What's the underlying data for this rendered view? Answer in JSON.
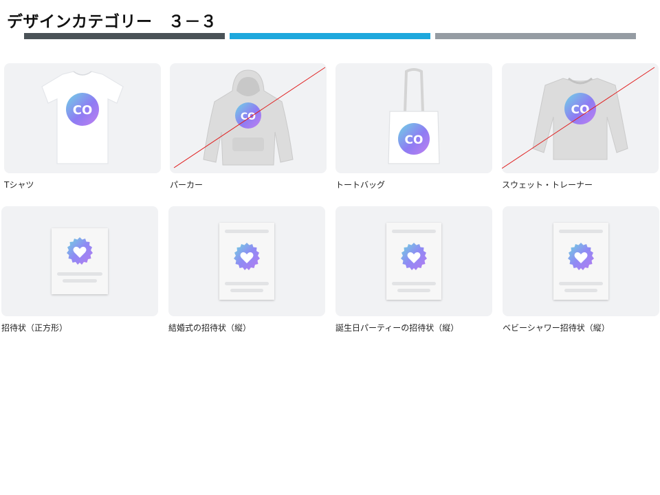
{
  "header": {
    "title": "デザインカテゴリー　３－３"
  },
  "progress": {
    "segments": [
      {
        "color": "#4a5257",
        "state": "done"
      },
      {
        "color": "#1ea8dd",
        "state": "current"
      },
      {
        "color": "#959ca3",
        "state": "upcoming"
      }
    ]
  },
  "colors": {
    "thumb_bg": "#f1f2f4",
    "strike": "#e02020",
    "logo_gradient": [
      "#7fd0e6",
      "#8b78f0",
      "#b77cf2"
    ]
  },
  "rows": [
    {
      "cards": [
        {
          "label": "Tシャツ",
          "image": "tshirt-mockup",
          "logo_text": "CO",
          "crossed_out": false
        },
        {
          "label": "パーカー",
          "image": "hoodie-mockup",
          "logo_text": "CO",
          "crossed_out": true
        },
        {
          "label": "トートバッグ",
          "image": "tote-bag-mockup",
          "logo_text": "CO",
          "crossed_out": false
        },
        {
          "label": "スウェット・トレーナー",
          "image": "sweatshirt-mockup",
          "logo_text": "CO",
          "crossed_out": true
        }
      ]
    },
    {
      "cards": [
        {
          "label": "招待状（正方形）",
          "image": "invitation-square",
          "crossed_out": false
        },
        {
          "label": "結婚式の招待状（縦）",
          "image": "wedding-invitation-portrait",
          "crossed_out": false
        },
        {
          "label": "誕生日パーティーの招待状（縦）",
          "image": "birthday-invitation-portrait",
          "crossed_out": false
        },
        {
          "label": "ベビーシャワー招待状（縦）",
          "image": "baby-shower-invitation-portrait",
          "crossed_out": false
        }
      ]
    }
  ]
}
